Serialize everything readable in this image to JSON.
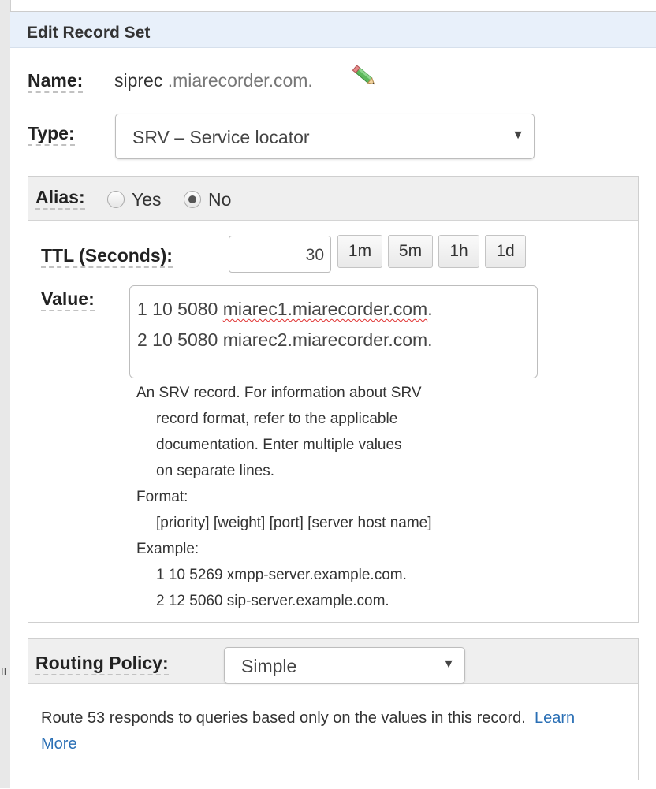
{
  "panel": {
    "title": "Edit Record Set"
  },
  "name": {
    "label": "Name:",
    "value": "siprec",
    "domain": " .miarecorder.com."
  },
  "type": {
    "label": "Type:",
    "selected": "SRV – Service locator",
    "caret": "▼"
  },
  "alias": {
    "label": "Alias:",
    "options": [
      {
        "label": "Yes",
        "checked": false
      },
      {
        "label": "No",
        "checked": true
      }
    ]
  },
  "ttl": {
    "label": "TTL (Seconds):",
    "value": "30",
    "buttons": [
      "1m",
      "5m",
      "1h",
      "1d"
    ]
  },
  "value": {
    "label": "Value:",
    "lines": [
      "1 10 5080 ",
      "miarec1.miarecorder.com",
      ".",
      "2 10 5080 miarec2.miarecorder.com."
    ],
    "help": [
      "An SRV record. For information about SRV",
      "record format, refer to the applicable",
      "documentation. Enter multiple values",
      "on separate lines.",
      "Format:",
      "[priority] [weight] [port] [server host name]",
      "Example:",
      "1 10 5269 xmpp-server.example.com.",
      "2 12 5060 sip-server.example.com."
    ]
  },
  "routing": {
    "label": "Routing Policy:",
    "selected": "Simple",
    "caret": "▼",
    "description": "Route 53 responds to queries based only on the values in this record.",
    "link_learn": "Learn",
    "link_more": "More"
  },
  "sidebar": {
    "grip": "II"
  },
  "colors": {
    "header_bg": "#e8f0fa",
    "link": "#2a6fb5",
    "box_head_bg": "#efefef"
  },
  "icons": {
    "edit": "pencil-icon"
  }
}
